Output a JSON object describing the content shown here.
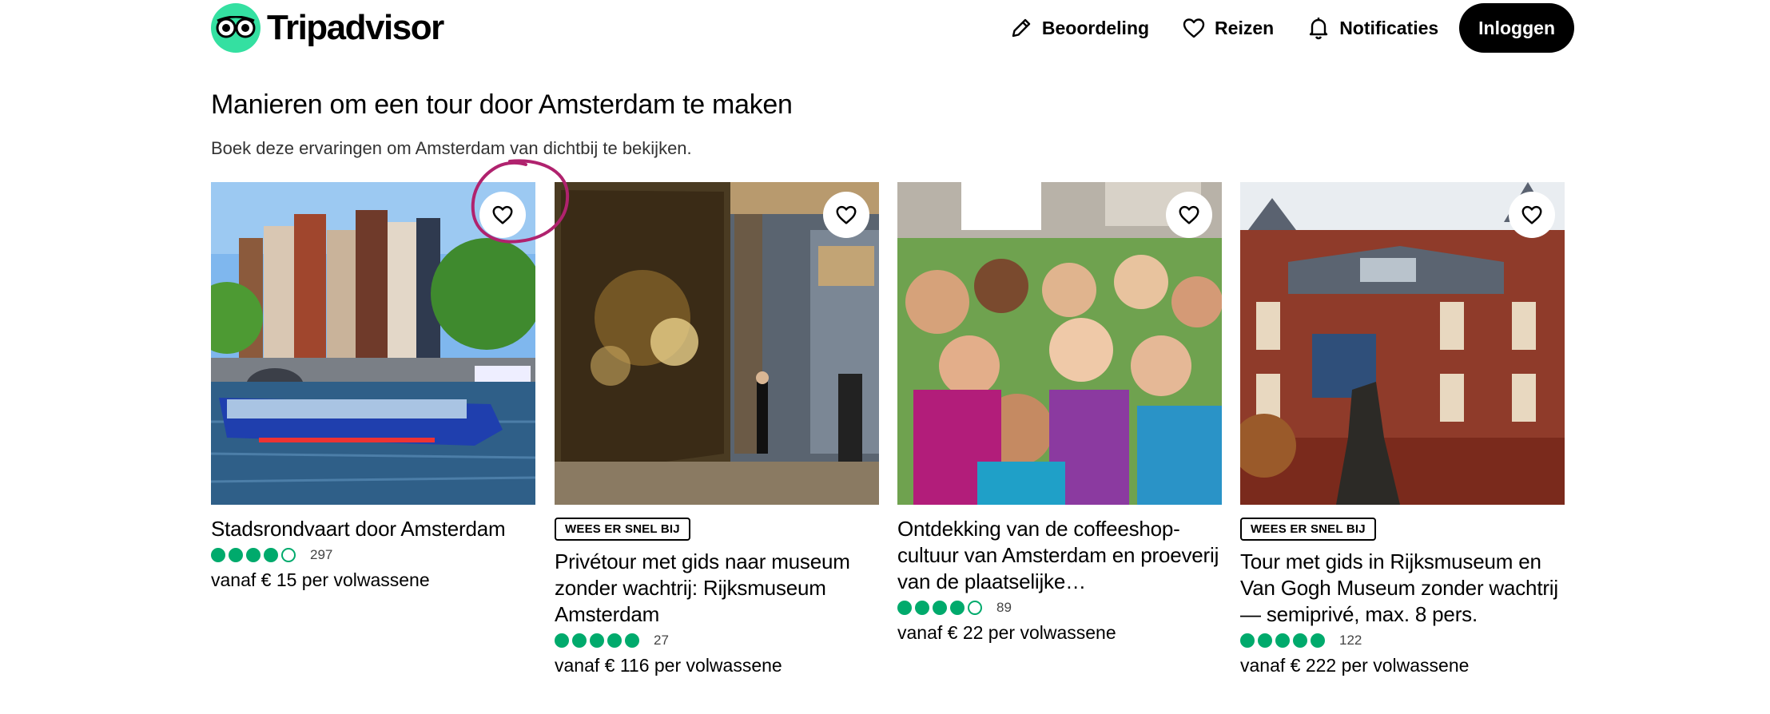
{
  "header": {
    "logo_text": "Tripadvisor",
    "nav": [
      {
        "label": "Beoordeling",
        "icon": "pencil-icon"
      },
      {
        "label": "Reizen",
        "icon": "heart-icon"
      },
      {
        "label": "Notificaties",
        "icon": "bell-icon"
      }
    ],
    "login_label": "Inloggen"
  },
  "section": {
    "title": "Manieren om een tour door Amsterdam te maken",
    "subtitle": "Boek deze ervaringen om Amsterdam van dichtbij te bekijken."
  },
  "cards": [
    {
      "badge": "",
      "title": "Stadsrondvaart door Amsterdam",
      "rating": 4,
      "review_count": "297",
      "price": "vanaf € 15 per volwassene"
    },
    {
      "badge": "WEES ER SNEL BIJ",
      "title": "Privétour met gids naar museum zonder wachtrij: Rijksmuseum Amsterdam",
      "rating": 5,
      "review_count": "27",
      "price": "vanaf € 116 per volwassene"
    },
    {
      "badge": "",
      "title": "Ontdekking van de coffeeshop-cultuur van Amsterdam en proeverij van de plaatselijke…",
      "rating": 4,
      "review_count": "89",
      "price": "vanaf € 22 per volwassene"
    },
    {
      "badge": "WEES ER SNEL BIJ",
      "title": "Tour met gids in Rijksmuseum en Van Gogh Museum zonder wachtrij — semiprivé, max. 8 pers.",
      "rating": 5,
      "review_count": "122",
      "price": "vanaf € 222 per volwassene"
    }
  ],
  "colors": {
    "brand_green": "#34e0a1",
    "rating_green": "#00aa6c",
    "annotation": "#b0226e"
  }
}
